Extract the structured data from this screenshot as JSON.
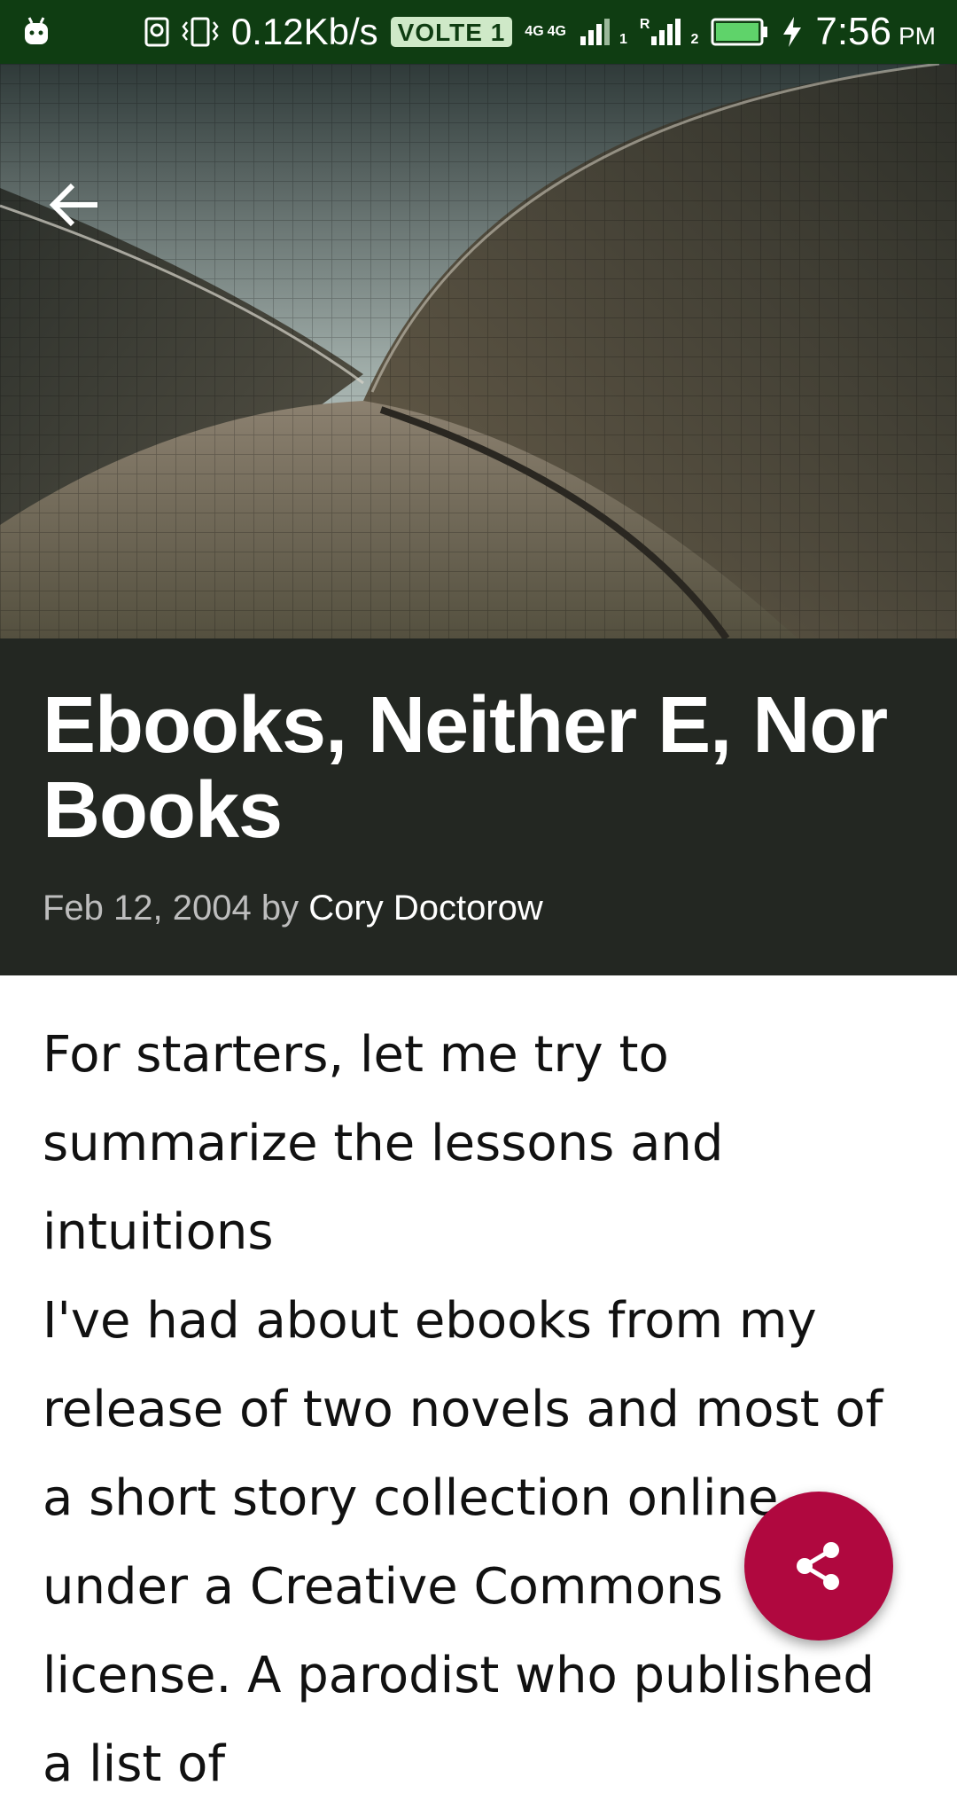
{
  "status_bar": {
    "speed": "0.12Kb/s",
    "volte": "VOLTE 1",
    "net_left": "4G",
    "net_right": "4G",
    "sim1": "1",
    "sim2": "2",
    "roaming": "R",
    "time": "7:56",
    "ampm": "PM"
  },
  "header": {
    "back_icon": "arrow-left-icon"
  },
  "article": {
    "title": "Ebooks, Neither E, Nor Books",
    "date": "Feb 12, 2004",
    "by": "by",
    "author": "Cory Doctorow",
    "paragraphs": [
      "For starters, let me try to summarize the lessons and intuitions",
      "I've had about ebooks from my release of two novels and most of a short story collection online under a Creative Commons license. A parodist who published a list of"
    ]
  },
  "fab": {
    "icon": "share-icon",
    "color": "#b0083f"
  },
  "colors": {
    "status_bar": "#0f3d12",
    "title_band": "#232722",
    "accent": "#b0083f"
  }
}
